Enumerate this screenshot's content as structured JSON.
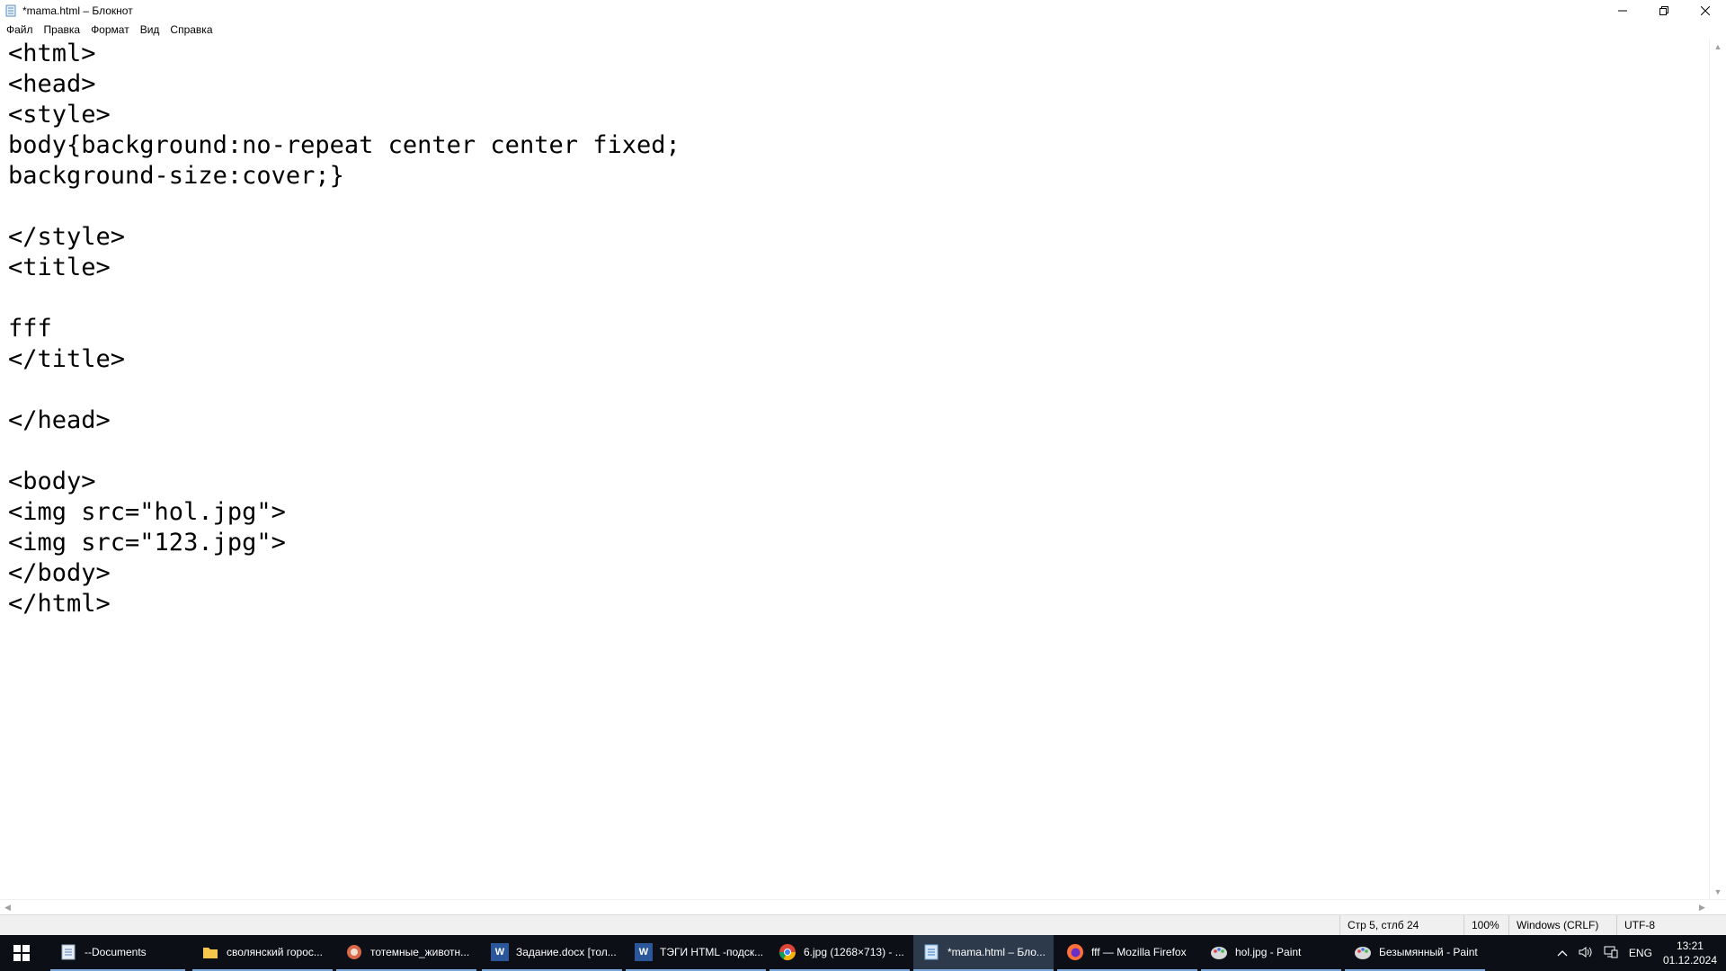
{
  "window": {
    "title": "*mama.html – Блокнот"
  },
  "controls": {
    "minimize": "—",
    "restore": "❐",
    "close": "✕"
  },
  "menu": [
    "Файл",
    "Правка",
    "Формат",
    "Вид",
    "Справка"
  ],
  "editor": {
    "lines": [
      "<html>",
      "<head>",
      "<style>",
      "body{background:no-repeat center center fixed;",
      "background-size:cover;}",
      "",
      "</style>",
      "<title>",
      "",
      "fff",
      "</title>",
      "",
      "</head>",
      "",
      "<body>",
      "<img src=\"hol.jpg\">",
      "<img src=\"123.jpg\">",
      "</body>",
      "</html>"
    ]
  },
  "statusbar": {
    "position": "Стр 5, стлб 24",
    "zoom": "100%",
    "line_ending": "Windows (CRLF)",
    "encoding": "UTF-8"
  },
  "taskbar": {
    "tasks": [
      {
        "label": "--Documents",
        "icon": "notepad-doc-icon"
      },
      {
        "label": "сволянский горос...",
        "icon": "folder-icon"
      },
      {
        "label": "тотемные_животн...",
        "icon": "image-viewer-icon"
      },
      {
        "label": "Задание.docx [тол...",
        "icon": "word-icon"
      },
      {
        "label": "ТЭГИ HTML -подск...",
        "icon": "word-icon"
      },
      {
        "label": "6.jpg (1268×713) - ...",
        "icon": "chrome-icon"
      },
      {
        "label": "*mama.html – Бло...",
        "icon": "notepad-icon"
      },
      {
        "label": "fff — Mozilla Firefox",
        "icon": "firefox-icon"
      },
      {
        "label": "hol.jpg - Paint",
        "icon": "paint-icon"
      },
      {
        "label": "Безымянный - Paint",
        "icon": "paint-icon"
      }
    ],
    "language": "ENG",
    "time": "13:21",
    "date": "01.12.2024"
  },
  "colors": {
    "taskbar_bg": "#0c0f16",
    "taskbar_active": "#2d3a4c",
    "task_underline": "#7aa7d8"
  }
}
